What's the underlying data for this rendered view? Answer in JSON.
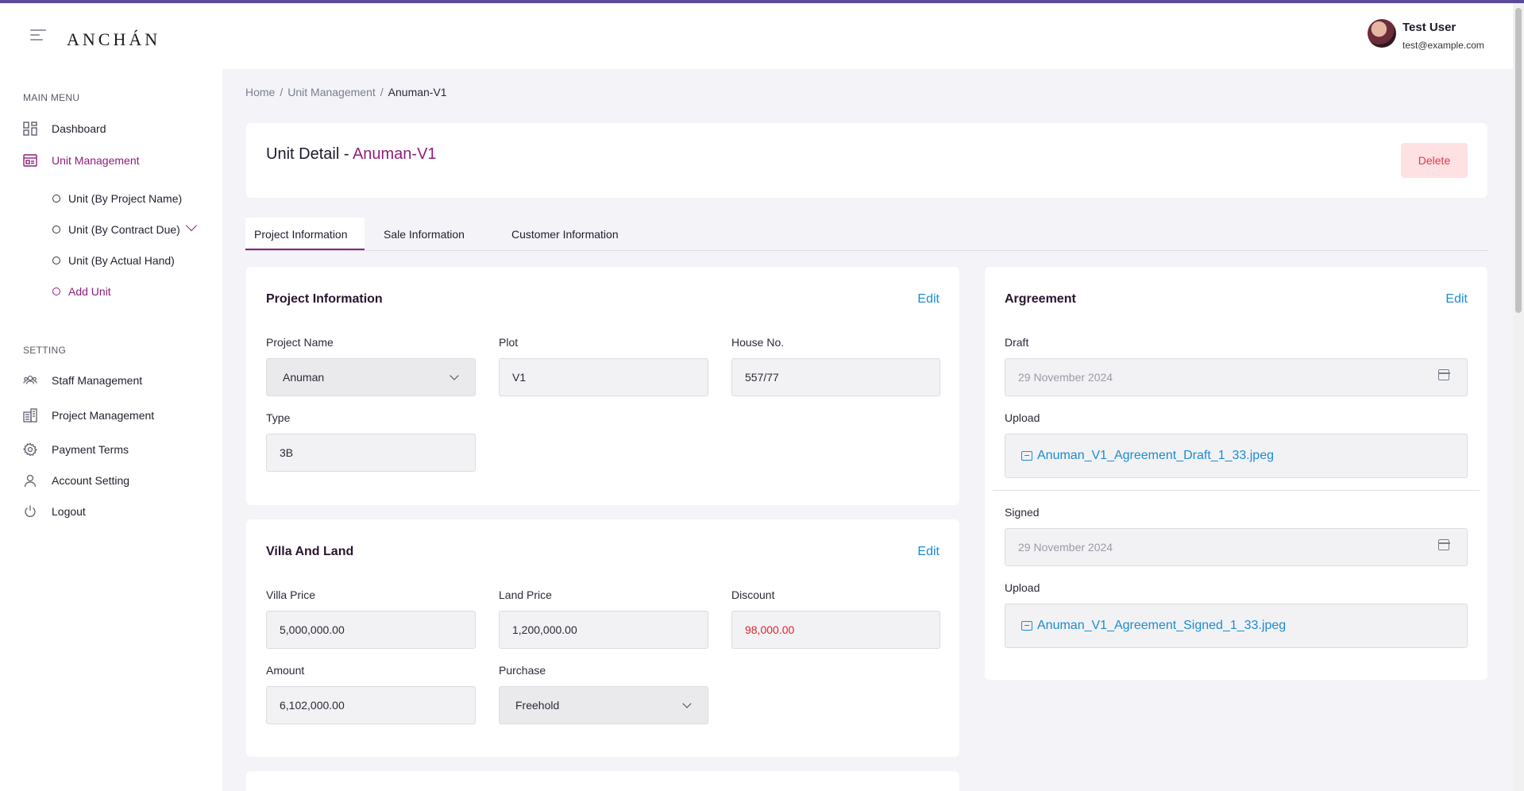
{
  "header": {
    "logo": "ANCHÁN",
    "user_name": "Test User",
    "user_email": "test@example.com"
  },
  "sidebar": {
    "main_menu_title": "MAIN MENU",
    "dashboard": "Dashboard",
    "unit_management": "Unit Management",
    "sub_items": [
      "Unit (By Project Name)",
      "Unit (By Contract Due)",
      "Unit (By Actual Hand)",
      "Add Unit"
    ],
    "setting_title": "SETTING",
    "settings": [
      "Staff Management",
      "Project Management",
      "Payment Terms",
      "Account Setting",
      "Logout"
    ]
  },
  "breadcrumb": {
    "home": "Home",
    "section": "Unit Management",
    "current": "Anuman-V1"
  },
  "page": {
    "title_prefix": "Unit Detail - ",
    "title_unit": "Anuman-V1",
    "delete_label": "Delete"
  },
  "tabs": [
    "Project Information",
    "Sale Information",
    "Customer Information"
  ],
  "project_info": {
    "title": "Project Information",
    "edit": "Edit",
    "project_name_label": "Project Name",
    "project_name": "Anuman",
    "plot_label": "Plot",
    "plot": "V1",
    "house_no_label": "House No.",
    "house_no": "557/77",
    "type_label": "Type",
    "type": "3B"
  },
  "villa_land": {
    "title": "Villa And Land",
    "edit": "Edit",
    "villa_price_label": "Villa Price",
    "villa_price": "5,000,000.00",
    "land_price_label": "Land Price",
    "land_price": "1,200,000.00",
    "discount_label": "Discount",
    "discount": "98,000.00",
    "amount_label": "Amount",
    "amount": "6,102,000.00",
    "purchase_label": "Purchase",
    "purchase": "Freehold"
  },
  "agreement": {
    "title": "Argreement",
    "edit": "Edit",
    "draft_label": "Draft",
    "draft_date": "29 November 2024",
    "upload_label": "Upload",
    "draft_file": "Anuman_V1_Agreement_Draft_1_33.jpeg",
    "signed_label": "Signed",
    "signed_date": "29 November 2024",
    "signed_file": "Anuman_V1_Agreement_Signed_1_33.jpeg"
  },
  "colors": {
    "accent": "#8e1e7a",
    "link": "#1d8bd1",
    "danger": "#e0384e"
  }
}
